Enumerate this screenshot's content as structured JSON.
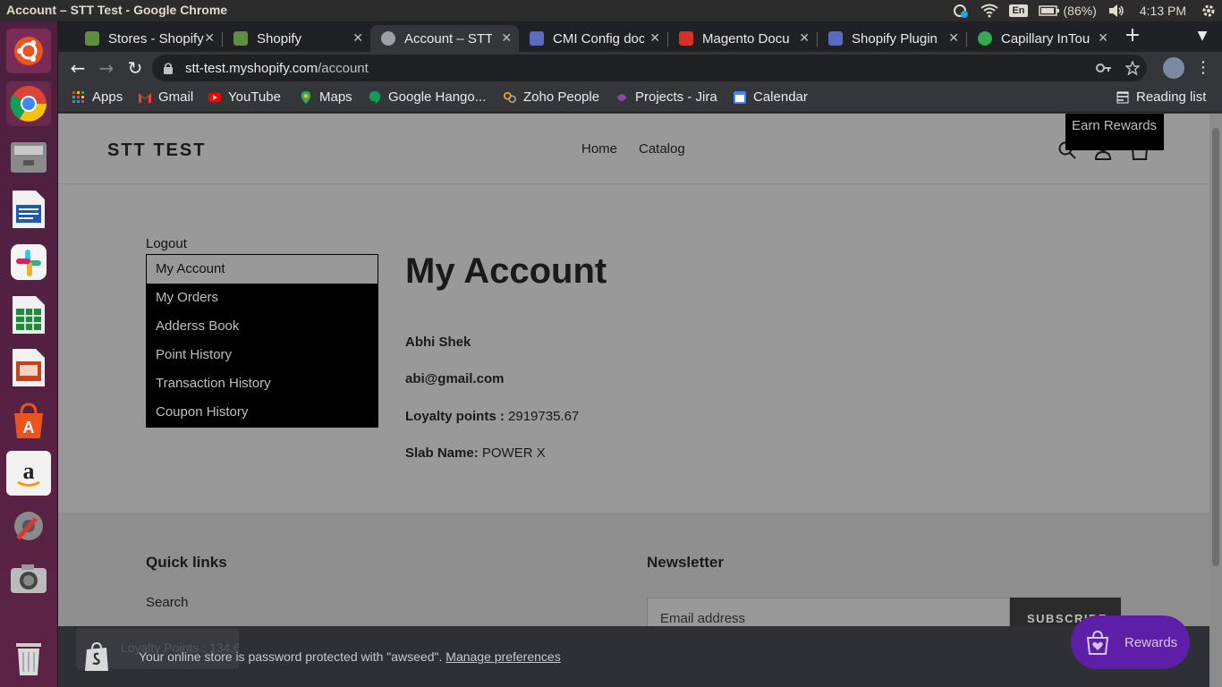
{
  "os": {
    "window_title": "Account – STT Test - Google Chrome",
    "lang_badge": "En",
    "battery": "(86%)",
    "clock": "4:13 PM"
  },
  "browser": {
    "tabs": [
      {
        "label": "Stores - Shopify",
        "color": "#5e8e3e"
      },
      {
        "label": "Shopify",
        "color": "#5e8e3e"
      },
      {
        "label": "Account – STT Test",
        "color": "#9aa0a6"
      },
      {
        "label": "CMI Config doc",
        "color": "#5c6bc0"
      },
      {
        "label": "Magento Docu",
        "color": "#d93025"
      },
      {
        "label": "Shopify Plugin",
        "color": "#5c6bc0"
      },
      {
        "label": "Capillary InTouch",
        "color": "#34a853"
      }
    ],
    "address_host": "stt-test.myshopify.com",
    "address_path": "/account",
    "bookmarks": [
      {
        "label": "Apps",
        "color": "#ea4335"
      },
      {
        "label": "Gmail",
        "color": "#ea4335"
      },
      {
        "label": "YouTube",
        "color": "#ff0000"
      },
      {
        "label": "Maps",
        "color": "#34a853"
      },
      {
        "label": "Google Hango...",
        "color": "#0f9d58"
      },
      {
        "label": "Zoho People",
        "color": "#f5a623"
      },
      {
        "label": "Projects - Jira",
        "color": "#8e44ad"
      },
      {
        "label": "Calendar",
        "color": "#4285f4"
      }
    ],
    "reading_list": "Reading list"
  },
  "site": {
    "logo": "STT TEST",
    "nav": [
      "Home",
      "Catalog"
    ],
    "earn_rewards": "Earn Rewards",
    "logout": "Logout",
    "menu": [
      "My Account",
      "My Orders",
      "Adderss Book",
      "Point History",
      "Transaction History",
      "Coupon History"
    ],
    "account_title": "My Account",
    "customer_name": "Abhi Shek",
    "customer_email": "abi@gmail.com",
    "loyalty_label": "Loyalty points :",
    "loyalty_value": "2919735.67",
    "slab_label": "Slab Name:",
    "slab_value": "POWER X",
    "footer": {
      "quick_links_heading": "Quick links",
      "quick_links": [
        "Search"
      ],
      "newsletter_heading": "Newsletter",
      "email_placeholder": "Email address",
      "subscribe_label": "SUBSCRIBE"
    },
    "password_bar_text": "Your online store is password protected with \"awseed\".",
    "password_bar_link": "Manage preferences",
    "loyalty_pill": "Loyalty Points : 134,635",
    "rewards_button": "Rewards"
  },
  "colors": {
    "rewards_purple": "#5e1fa8",
    "page_overlay_gray": "#999999",
    "menu_black": "#000000"
  }
}
